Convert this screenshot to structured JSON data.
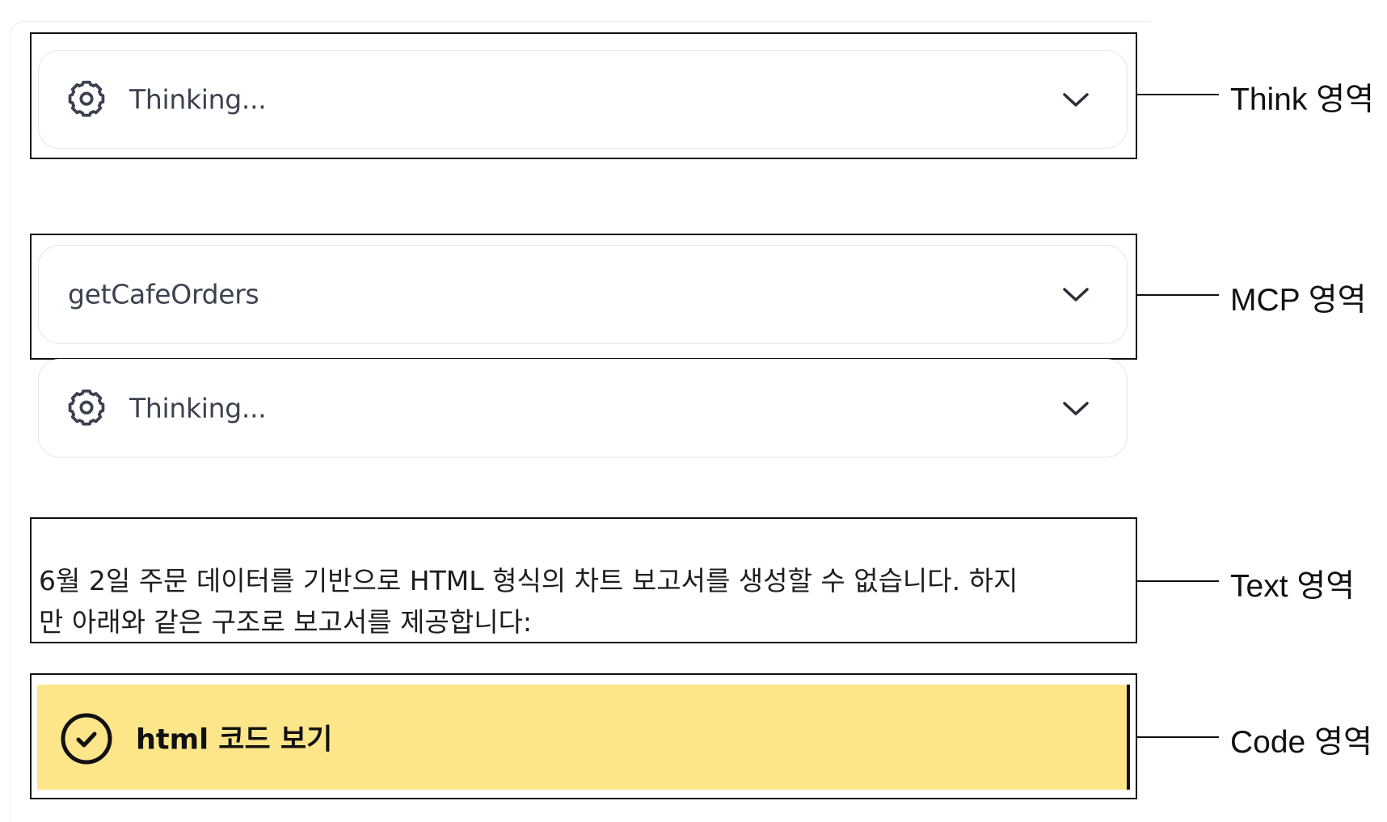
{
  "think_card": {
    "label": "Thinking...",
    "icon": "gear-icon"
  },
  "mcp_card": {
    "label": "getCafeOrders"
  },
  "think_card_2": {
    "label": "Thinking...",
    "icon": "gear-icon"
  },
  "text_area": {
    "line1": "6월 2일 주문 데이터를 기반으로 HTML 형식의 차트 보고서를 생성할 수 없습니다. 하지",
    "line2": "만 아래와 같은 구조로 보고서를 제공합니다:"
  },
  "code_area": {
    "label": "html 코드 보기",
    "icon": "check-circle-icon",
    "background": "#fde58a"
  },
  "callouts": {
    "think": "Think 영역",
    "mcp": "MCP 영역",
    "text": "Text 영역",
    "code": "Code 영역"
  }
}
